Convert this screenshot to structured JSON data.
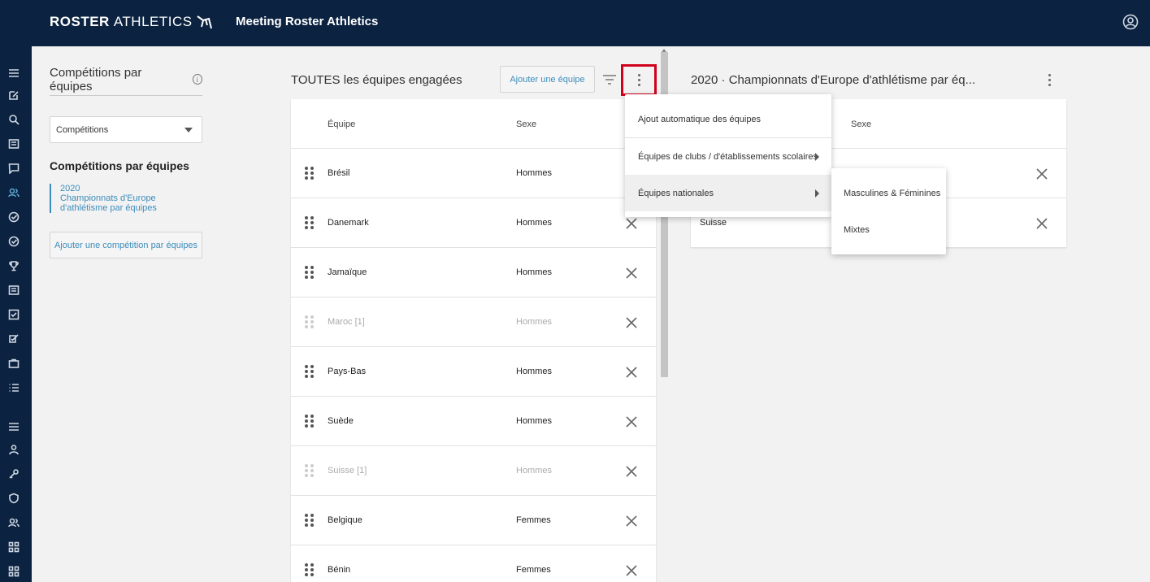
{
  "header": {
    "brand_bold": "ROSTER",
    "brand_thin": "ATHLETICS",
    "app_title": "Meeting Roster Athletics",
    "account_icon": "account-circle-icon"
  },
  "rail": {
    "icons": [
      "menu-icon",
      "edit-icon",
      "search-icon",
      "list-icon",
      "chat-icon",
      "team-icon",
      "check-circle-icon",
      "check-circle-icon",
      "trophy-icon",
      "document-icon",
      "checkbox-icon",
      "checklist-icon",
      "briefcase-icon",
      "bullet-list-icon",
      "menu-icon",
      "person-icon",
      "key-icon",
      "shield-icon",
      "team-icon",
      "grid-icon",
      "grid-icon"
    ]
  },
  "left": {
    "title": "Compétitions par équipes",
    "select_value": "Compétitions",
    "section_title": "Compétitions par équipes",
    "competition_year": "2020",
    "competition_name": "Championnats d'Europe d'athlétisme par équipes",
    "add_button": "Ajouter une compétition par équipes"
  },
  "middle": {
    "title": "TOUTES les équipes engagées",
    "add_button": "Ajouter une équipe",
    "col_team": "Équipe",
    "col_sex": "Sexe",
    "rows": [
      {
        "team": "Brésil",
        "sex": "Hommes"
      },
      {
        "team": "Danemark",
        "sex": "Hommes"
      },
      {
        "team": "Jamaïque",
        "sex": "Hommes"
      },
      {
        "team": "Maroc [1]",
        "sex": "Hommes"
      },
      {
        "team": "Pays-Bas",
        "sex": "Hommes"
      },
      {
        "team": "Suède",
        "sex": "Hommes"
      },
      {
        "team": "Suisse [1]",
        "sex": "Hommes"
      },
      {
        "team": "Belgique",
        "sex": "Femmes"
      },
      {
        "team": "Bénin",
        "sex": "Femmes"
      }
    ]
  },
  "right": {
    "title": "2020 · Championnats d'Europe d'athlétisme par éq...",
    "col_sex": "Sexe",
    "rows": [
      {
        "team": ""
      },
      {
        "team": "Suisse"
      }
    ]
  },
  "menu": {
    "items": [
      "Ajout automatique des équipes",
      "Équipes de clubs / d'établissements scolaires",
      "Équipes nationales"
    ],
    "submenu": [
      "Masculines & Féminines",
      "Mixtes"
    ]
  },
  "colors": {
    "navy": "#0b2240",
    "accent": "#3c8dbc",
    "highlight": "#d0021b"
  }
}
